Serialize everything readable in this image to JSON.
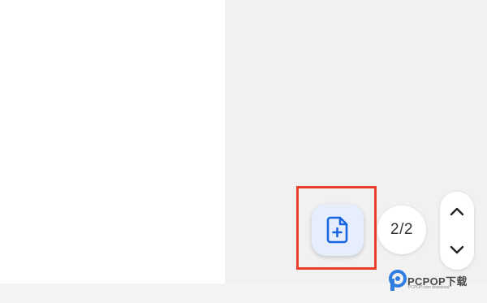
{
  "toolbar": {
    "new_file_icon": "file-plus-icon",
    "new_file_accent": "#1a66e0",
    "page_indicator": "2/2",
    "prev_icon": "chevron-up-icon",
    "next_icon": "chevron-down-icon"
  },
  "highlight": {
    "color": "#e8402a"
  },
  "watermark": {
    "brand": "PCPOP下载",
    "tagline": "PCPOP.com download"
  }
}
